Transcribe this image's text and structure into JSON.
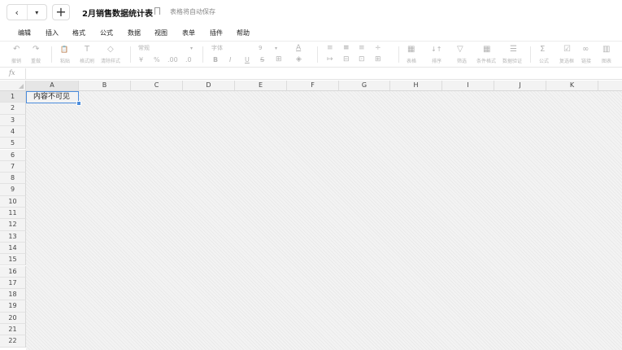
{
  "titlebar": {
    "back_icon": "‹",
    "dropdown_icon": "▾",
    "new_icon": "+",
    "title": "2月销售数据统计表",
    "autosave": "表格将自动保存"
  },
  "menu": [
    "编辑",
    "插入",
    "格式",
    "公式",
    "数据",
    "视图",
    "表单",
    "插件",
    "帮助"
  ],
  "toolbar": {
    "undo": {
      "icon": "↶",
      "label": "撤销"
    },
    "redo": {
      "icon": "↷",
      "label": "重做"
    },
    "paste": {
      "icon": "📋",
      "label": "粘贴"
    },
    "format_painter": {
      "icon": "T",
      "label": "格式刷"
    },
    "clear_format": {
      "icon": "◇",
      "label": "清除样式"
    },
    "number_format": "常规",
    "currency": "¥",
    "percent": "%",
    "dec_decrease": ".00",
    "dec_increase": ".0",
    "font_family": "字体",
    "font_size": "9",
    "bold": "B",
    "italic": "I",
    "underline": "U",
    "strike": "S",
    "border": "⊞",
    "font_color": "A",
    "fill_color": "◈",
    "align_left": "≡",
    "align_center": "≡",
    "align_right": "≡",
    "valign": "÷",
    "wrap": "↦",
    "merge": "⊟",
    "freeze": "⊡",
    "insert": "⊞",
    "table": {
      "icon": "▦",
      "label": "表格"
    },
    "sort": {
      "icon": "↓↑",
      "label": "排序"
    },
    "filter": {
      "icon": "▽",
      "label": "筛选"
    },
    "cond_format": {
      "icon": "▦",
      "label": "条件格式"
    },
    "validation": {
      "icon": "☰",
      "label": "数据验证"
    },
    "formula": {
      "icon": "Σ",
      "label": "公式"
    },
    "checkbox": {
      "icon": "☑",
      "label": "复选框"
    },
    "link": {
      "icon": "∞",
      "label": "链接"
    },
    "chart": {
      "icon": "▥",
      "label": "图表"
    }
  },
  "formula_bar": {
    "fx": "fx"
  },
  "columns": [
    "A",
    "B",
    "C",
    "D",
    "E",
    "F",
    "G",
    "H",
    "I",
    "J",
    "K"
  ],
  "rows": [
    "1",
    "2",
    "3",
    "4",
    "5",
    "6",
    "7",
    "8",
    "9",
    "10",
    "11",
    "12",
    "13",
    "14",
    "15",
    "16",
    "17",
    "18",
    "19",
    "20",
    "21",
    "22"
  ],
  "cells": {
    "A1": "内容不可见"
  },
  "colors": {
    "selection": "#4b8cdc"
  }
}
